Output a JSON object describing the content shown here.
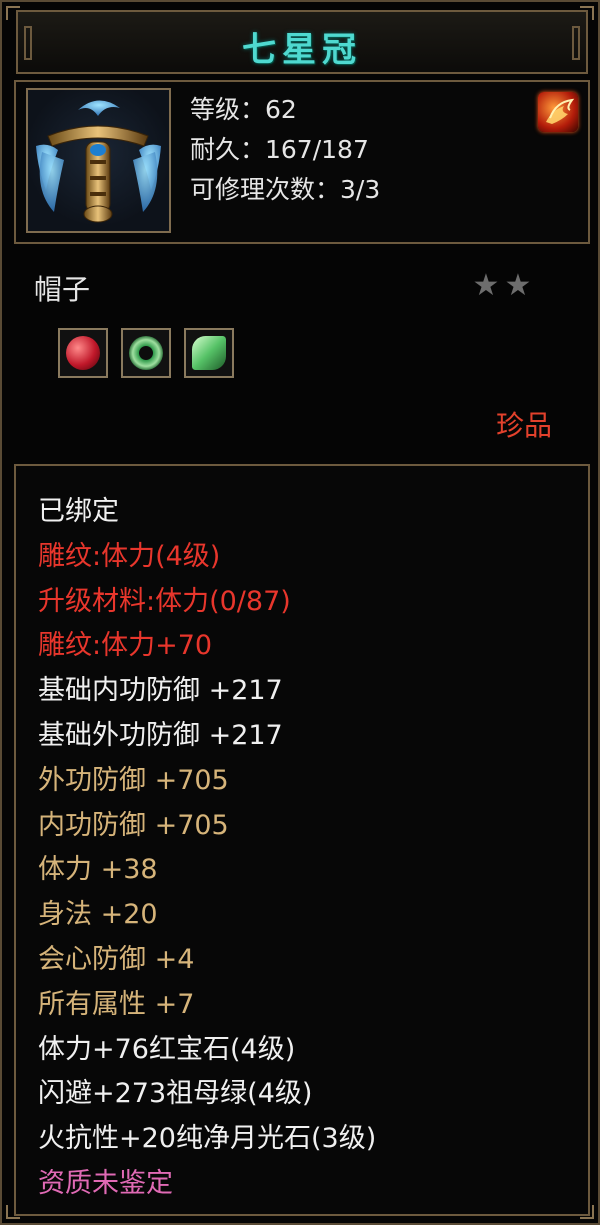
{
  "item": {
    "name": "七星冠",
    "level_line": "等级：62",
    "durability_line": "耐久：167/187",
    "repair_line": "可修理次数：3/3",
    "type": "帽子",
    "stars": [
      "★",
      "★"
    ],
    "quality": "珍品"
  },
  "gems": [
    {
      "name": "red-gem",
      "color": "#c0182a"
    },
    {
      "name": "emerald-gem",
      "color": "#2f9a4a"
    },
    {
      "name": "moonstone-gem",
      "color": "#56c267"
    }
  ],
  "colors": {
    "title": "#4fd9d0",
    "white": "#f0f0f0",
    "red": "#e8362c",
    "gold": "#d6b47a",
    "pink": "#e06ab5",
    "frame": "#6d5a3e"
  },
  "attributes": [
    {
      "text": "已绑定",
      "color": "white"
    },
    {
      "text": "雕纹:体力(4级)",
      "color": "red"
    },
    {
      "text": "升级材料:体力(0/87)",
      "color": "red"
    },
    {
      "text": "雕纹:体力+70",
      "color": "red"
    },
    {
      "text": "基础内功防御  +217",
      "color": "white"
    },
    {
      "text": "基础外功防御  +217",
      "color": "white"
    },
    {
      "text": "外功防御  +705",
      "color": "gold"
    },
    {
      "text": "内功防御  +705",
      "color": "gold"
    },
    {
      "text": "体力  +38",
      "color": "gold"
    },
    {
      "text": "身法  +20",
      "color": "gold"
    },
    {
      "text": "会心防御  +4",
      "color": "gold"
    },
    {
      "text": "所有属性  +7",
      "color": "gold"
    },
    {
      "text": "体力+76红宝石(4级)",
      "color": "white"
    },
    {
      "text": "闪避+273祖母绿(4级)",
      "color": "white"
    },
    {
      "text": "火抗性+20纯净月光石(3级)",
      "color": "white"
    },
    {
      "text": "资质未鉴定",
      "color": "pink"
    }
  ]
}
